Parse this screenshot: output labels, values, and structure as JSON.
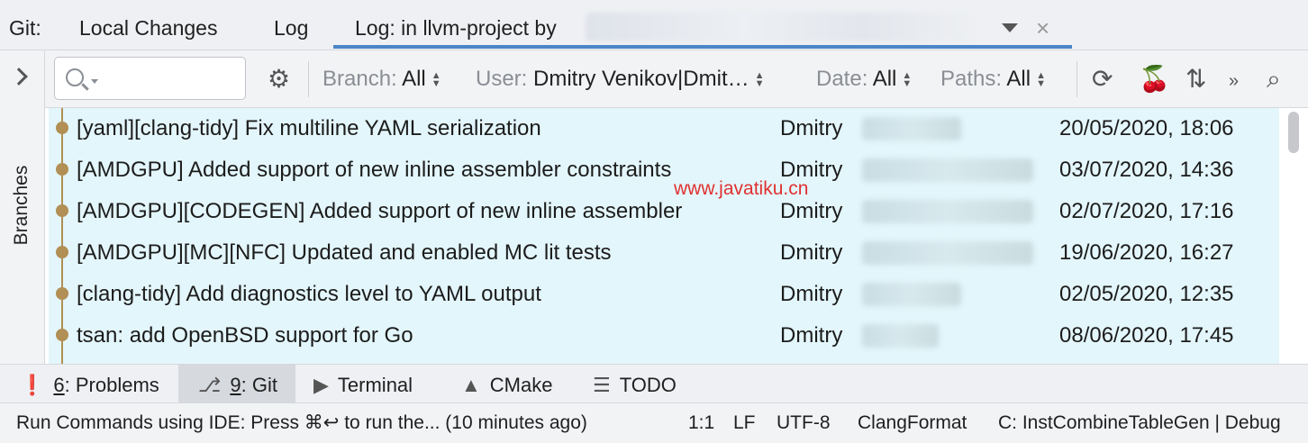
{
  "tabs": {
    "prefix": "Git:",
    "items": [
      {
        "label": "Local Changes"
      },
      {
        "label": "Log"
      },
      {
        "label": "Log: in llvm-project by"
      }
    ]
  },
  "sidebar": {
    "label": "Branches"
  },
  "toolbar": {
    "search_placeholder": "",
    "branch": {
      "key": "Branch:",
      "value": "All"
    },
    "user": {
      "key": "User:",
      "value": "Dmitry Venikov|Dmit…"
    },
    "date": {
      "key": "Date:",
      "value": "All"
    },
    "paths": {
      "key": "Paths:",
      "value": "All"
    },
    "more": "»"
  },
  "commits": [
    {
      "subject": "[yaml][clang-tidy] Fix multiline YAML serialization",
      "author": "Dmitry",
      "date": "20/05/2020, 18:06"
    },
    {
      "subject": "[AMDGPU] Added support of new inline assembler constraints",
      "author": "Dmitry",
      "date": "03/07/2020, 14:36"
    },
    {
      "subject": "[AMDGPU][CODEGEN] Added support of new inline assembler",
      "author": "Dmitry",
      "date": "02/07/2020, 17:16"
    },
    {
      "subject": "[AMDGPU][MC][NFC] Updated and enabled MC lit tests",
      "author": "Dmitry",
      "date": "19/06/2020, 16:27"
    },
    {
      "subject": "[clang-tidy] Add diagnostics level to YAML output",
      "author": "Dmitry",
      "date": "02/05/2020, 12:35"
    },
    {
      "subject": "tsan: add OpenBSD support for Go",
      "author": "Dmitry",
      "date": "08/06/2020, 17:45"
    }
  ],
  "watermark": "www.javatiku.cn",
  "tool_windows": [
    {
      "num": "6",
      "label": ": Problems",
      "icon": "problems-icon"
    },
    {
      "num": "9",
      "label": ": Git",
      "icon": "git-icon"
    },
    {
      "num": "",
      "label": "Terminal",
      "icon": "terminal-icon"
    },
    {
      "num": "",
      "label": "CMake",
      "icon": "cmake-icon"
    },
    {
      "num": "",
      "label": "TODO",
      "icon": "todo-icon"
    }
  ],
  "status": {
    "message": "Run Commands using IDE: Press ⌘↩ to run the... (10 minutes ago)",
    "position": "1:1",
    "line_sep": "LF",
    "encoding": "UTF-8",
    "formatter": "ClangFormat",
    "context": "C: InstCombineTableGen | Debug"
  },
  "colors": {
    "accent": "#4a86c8",
    "row_bg": "#e3f6fb",
    "graph": "#b18f55",
    "watermark": "#e03131"
  }
}
